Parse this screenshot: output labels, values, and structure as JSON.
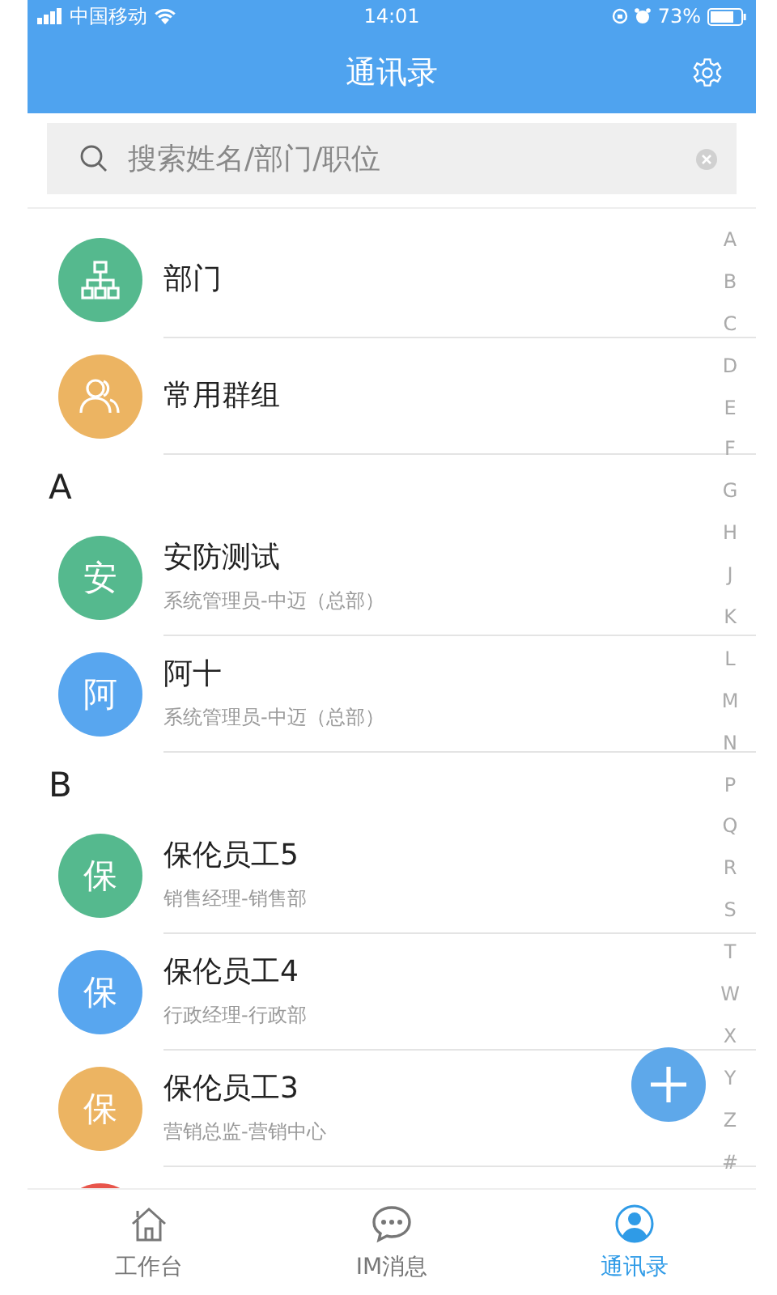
{
  "status_bar": {
    "carrier": "中国移动",
    "time": "14:01",
    "battery": "73%"
  },
  "nav": {
    "title": "通讯录"
  },
  "search": {
    "placeholder": "搜索姓名/部门/职位"
  },
  "shortcuts": [
    {
      "label": "部门",
      "kind": "department",
      "color": "#55b98e"
    },
    {
      "label": "常用群组",
      "kind": "group",
      "color": "#ecb462"
    }
  ],
  "sections": [
    {
      "letter": "A",
      "contacts": [
        {
          "avatar": "安",
          "name": "安防测试",
          "subtitle": "系统管理员-中迈（总部）",
          "color": "#55b98e"
        },
        {
          "avatar": "阿",
          "name": "阿十",
          "subtitle": "系统管理员-中迈（总部）",
          "color": "#58a6ef"
        }
      ]
    },
    {
      "letter": "B",
      "contacts": [
        {
          "avatar": "保",
          "name": "保伦员工5",
          "subtitle": "销售经理-销售部",
          "color": "#55b98e"
        },
        {
          "avatar": "保",
          "name": "保伦员工4",
          "subtitle": "行政经理-行政部",
          "color": "#58a6ef"
        },
        {
          "avatar": "保",
          "name": "保伦员工3",
          "subtitle": "营销总监-营销中心",
          "color": "#ecb462"
        },
        {
          "color": "#e8554b"
        }
      ]
    }
  ],
  "index": [
    "A",
    "B",
    "C",
    "D",
    "E",
    "F",
    "G",
    "H",
    "J",
    "K",
    "L",
    "M",
    "N",
    "P",
    "Q",
    "R",
    "S",
    "T",
    "W",
    "X",
    "Y",
    "Z",
    "#"
  ],
  "tabs": [
    {
      "label": "工作台",
      "selected": false
    },
    {
      "label": "IM消息",
      "selected": false
    },
    {
      "label": "通讯录",
      "selected": true
    }
  ]
}
